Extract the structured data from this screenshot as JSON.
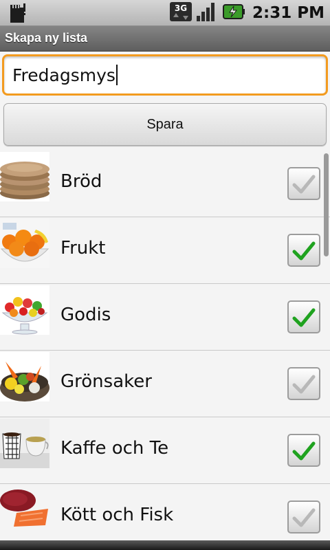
{
  "status_bar": {
    "time": "2:31 PM",
    "network": "3G",
    "icons": [
      "sd-card-icon",
      "network-3g-icon",
      "signal-icon",
      "battery-charging-icon"
    ]
  },
  "title_bar": {
    "title": "Skapa ny lista"
  },
  "list_name_input": {
    "value": "Fredagsmys"
  },
  "save_button": {
    "label": "Spara"
  },
  "categories": [
    {
      "label": "Bröd",
      "checked": false,
      "image": "bread"
    },
    {
      "label": "Frukt",
      "checked": true,
      "image": "fruit"
    },
    {
      "label": "Godis",
      "checked": true,
      "image": "candy"
    },
    {
      "label": "Grönsaker",
      "checked": false,
      "image": "vegetables"
    },
    {
      "label": "Kaffe och Te",
      "checked": true,
      "image": "coffee-tea"
    },
    {
      "label": "Kött och Fisk",
      "checked": false,
      "image": "meat-fish"
    }
  ],
  "colors": {
    "focus_border": "#f39b1f",
    "check_green": "#1fa21f",
    "check_gray": "#b8b8b8"
  }
}
